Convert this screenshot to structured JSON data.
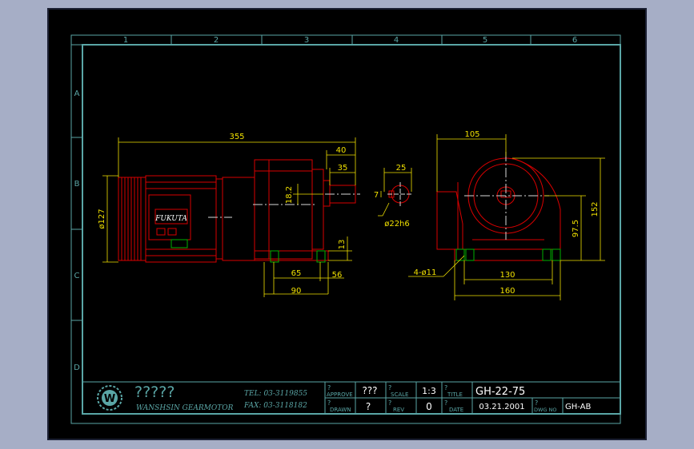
{
  "colors": {
    "background": "#a6aec6",
    "sheet": "#000000",
    "border": "#5aa6a6",
    "dimension": "#f0e000",
    "part": "#d80000",
    "centerline": "#d8d8d8",
    "fastener": "#00b000",
    "logo": "#5aa6a6"
  },
  "grid": {
    "columns": [
      "1",
      "2",
      "3",
      "4",
      "5",
      "6"
    ],
    "rows": [
      "A",
      "B",
      "C",
      "D"
    ]
  },
  "side_view": {
    "motor_label": "FUKUTA",
    "dims": {
      "overall_length": "355",
      "shaft_40": "40",
      "shaft_35": "35",
      "height_18_2": "18.2",
      "foot_13": "13",
      "base_65": "65",
      "base_56": "56",
      "base_90": "90",
      "diameter_127": "ø127"
    }
  },
  "shaft_detail": {
    "dims": {
      "width_25": "25",
      "key_7": "7",
      "shaft_dia": "ø22h6"
    }
  },
  "front_view": {
    "dims": {
      "width_105": "105",
      "height_152": "152",
      "center_97_5": "97.5",
      "holes": "4-ø11",
      "span_130": "130",
      "span_160": "160"
    }
  },
  "title_block": {
    "logo_letter": "W",
    "company_name": "?????",
    "company_subtitle": "WANSHSIN GEARMOTOR",
    "tel": "TEL:  03-3119855",
    "fax": "FAX:  03-3118182",
    "approve_label": "APPROVE",
    "approve_value": "???",
    "drawn_label": "DRAWN",
    "drawn_value": "?",
    "scale_label": "SCALE",
    "scale_value": "1:3",
    "rev_label": "REV",
    "rev_value": "0",
    "title_label": "TITLE",
    "title_value": "GH-22-75",
    "date_label": "DATE",
    "date_value": "03.21.2001",
    "dwg_label": "DWG NO",
    "dwg_value": "GH-AB",
    "q_mark": "?"
  }
}
